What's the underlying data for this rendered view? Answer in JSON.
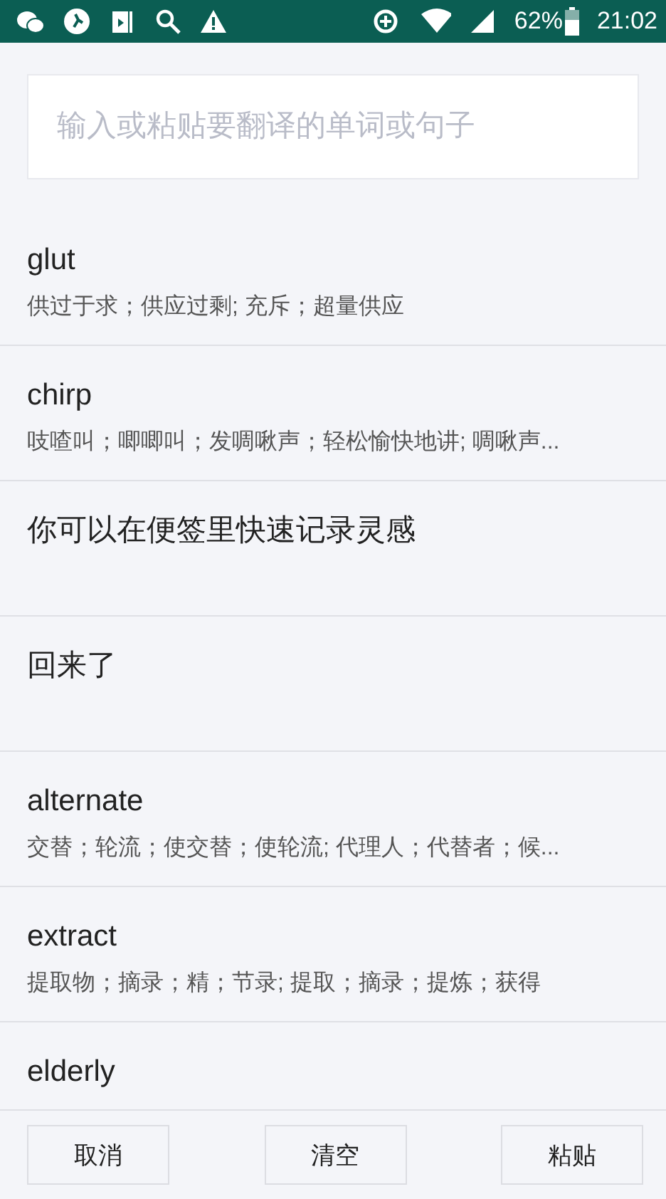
{
  "status_bar": {
    "battery": "62%",
    "time": "21:02"
  },
  "search": {
    "placeholder": "输入或粘贴要翻译的单词或句子"
  },
  "history": [
    {
      "word": "glut",
      "meaning": "供过于求；供应过剩; 充斥；超量供应"
    },
    {
      "word": "chirp",
      "meaning": "吱喳叫；唧唧叫；发啁啾声；轻松愉快地讲; 啁啾声..."
    },
    {
      "word": "你可以在便签里快速记录灵感"
    },
    {
      "word": "回来了"
    },
    {
      "word": "alternate",
      "meaning": "交替；轮流；使交替；使轮流; 代理人；代替者；候..."
    },
    {
      "word": "extract",
      "meaning": "提取物；摘录；精；节录; 提取；摘录；提炼；获得"
    },
    {
      "word": "elderly"
    }
  ],
  "buttons": [
    "取消",
    "清空",
    "粘贴"
  ]
}
